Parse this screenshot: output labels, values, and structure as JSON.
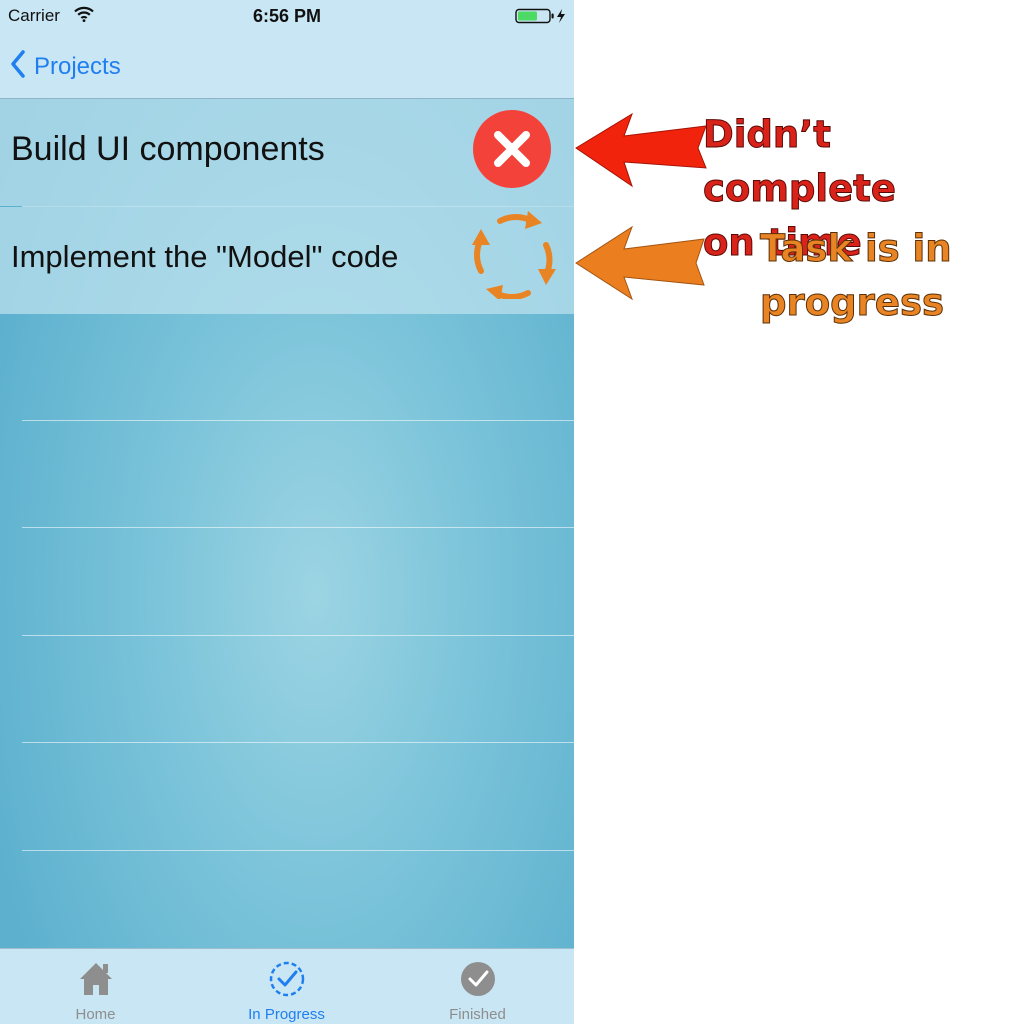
{
  "status_bar": {
    "carrier": "Carrier",
    "time": "6:56 PM"
  },
  "nav": {
    "back_label": "Projects"
  },
  "tasks": [
    {
      "title": "Build UI components",
      "status_icon": "error-x-icon",
      "status_color": "#f2423a"
    },
    {
      "title": "Implement the \"Model\" code",
      "status_icon": "refresh-arrows-icon",
      "status_color": "#e88423"
    }
  ],
  "tab_bar": {
    "tabs": [
      {
        "label": "Home",
        "icon": "house-icon",
        "selected": false
      },
      {
        "label": "In Progress",
        "icon": "dashed-check-circle-icon",
        "selected": true
      },
      {
        "label": "Finished",
        "icon": "check-circle-icon",
        "selected": false
      }
    ]
  },
  "annotations": {
    "overdue": {
      "line1": "Didn’t complete",
      "line2": "on time",
      "color": "#d9231a"
    },
    "in_progress": {
      "line1": "Task is in",
      "line2": "progress",
      "color": "#e88423"
    }
  },
  "colors": {
    "accent": "#1f7ff0",
    "bar_background": "#c9e6f4"
  }
}
